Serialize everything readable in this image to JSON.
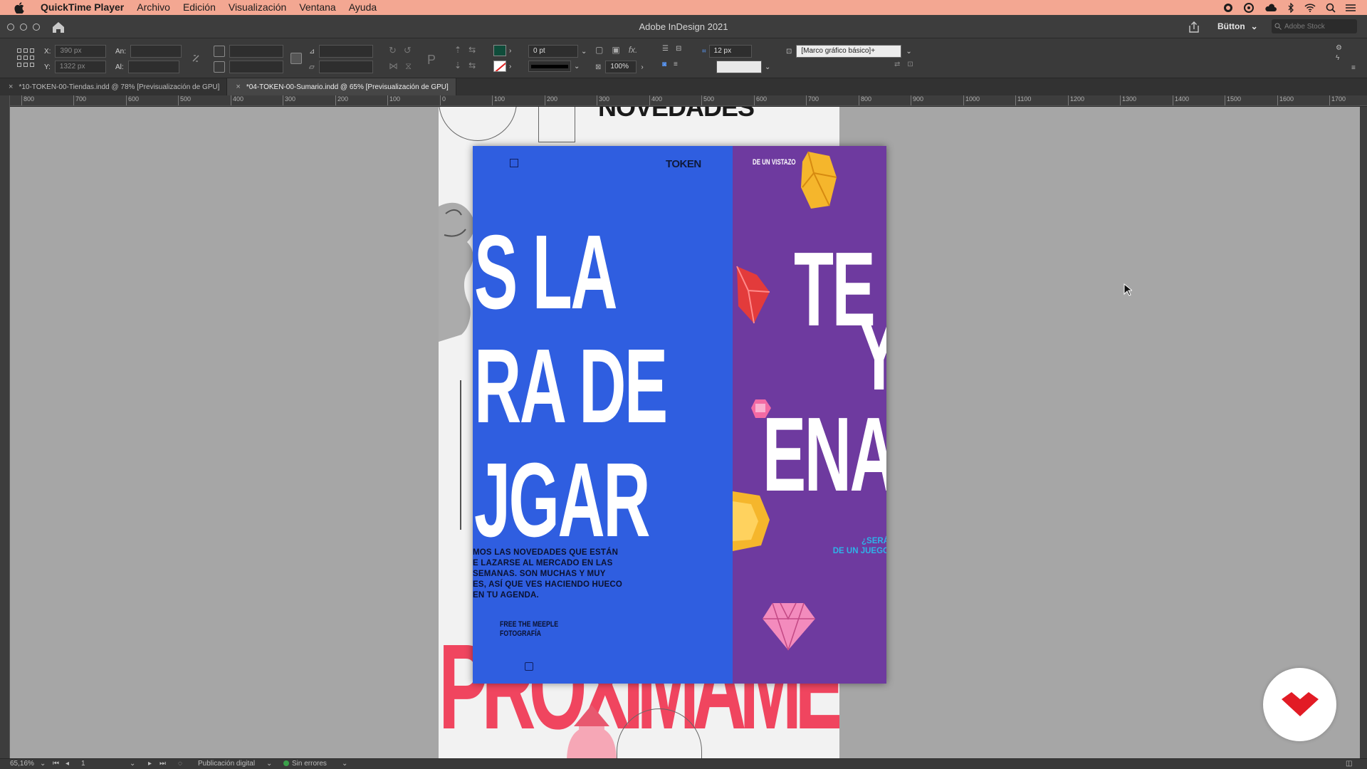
{
  "menubar": {
    "app_name": "QuickTime Player",
    "items": [
      "Archivo",
      "Edición",
      "Visualización",
      "Ventana",
      "Ayuda"
    ]
  },
  "window": {
    "title": "Adobe InDesign 2021",
    "workspace": "Bütton",
    "stock_placeholder": "Adobe Stock"
  },
  "control": {
    "x_label": "X:",
    "x_value": "390 px",
    "y_label": "Y:",
    "y_value": "1322 px",
    "w_label": "An:",
    "h_label": "Al:",
    "stroke_weight": "0 pt",
    "opacity": "100%",
    "offset": "12 px",
    "object_style": "[Marco gráfico básico]+"
  },
  "tabs": [
    {
      "label": "*10-TOKEN-00-Tiendas.indd @ 78% [Previsualización de GPU]",
      "active": false
    },
    {
      "label": "*04-TOKEN-00-Sumario.indd @ 65% [Previsualización de GPU]",
      "active": true
    }
  ],
  "ruler": [
    "800",
    "700",
    "600",
    "500",
    "400",
    "300",
    "200",
    "100",
    "0",
    "100",
    "200",
    "300",
    "400",
    "500",
    "600",
    "700",
    "800",
    "900",
    "1000",
    "1100",
    "1200",
    "1300",
    "1400",
    "1500",
    "1600",
    "1700"
  ],
  "spread": {
    "blue_logo": "TOKEN",
    "big_line_1": "S LA",
    "big_line_2": "RA DE",
    "big_line_3": "JGAR",
    "intro": "MOS LAS NOVEDADES QUE ESTÁN\nE LAZARSE AL MERCADO EN LAS\nSEMANAS. SON MUCHAS Y MUY\nES, ASÍ QUE VES HACIENDO HUECO\n   EN TU AGENDA.",
    "credit_line_1": "FREE THE MEEPLE",
    "credit_line_2": "FOTOGRAFÍA",
    "purple_label": "DE UN VISTAZO",
    "purple_big_1": "TE",
    "purple_big_2": "Y",
    "purple_big_3": "ENA",
    "purple_question": "¿SERÁ\nDE UN JUEGO"
  },
  "back_page": {
    "top_heading": "NOVEDADES",
    "bottom_word": "PROXIMAMENTE"
  },
  "status": {
    "zoom": "65,16%",
    "page": "1",
    "mode": "Publicación digital",
    "errors": "Sin errores"
  },
  "colors": {
    "menubar": "#f3a792",
    "blue_page": "#2f5ee0",
    "purple_page": "#6e3a9f",
    "pink_text": "#f0455f"
  }
}
